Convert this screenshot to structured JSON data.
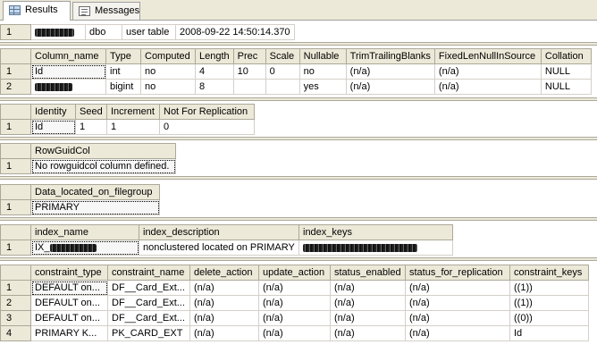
{
  "tabs": [
    {
      "label": "Results",
      "icon": "results-grid-icon"
    },
    {
      "label": "Messages",
      "icon": "messages-icon"
    }
  ],
  "rs1": {
    "row": {
      "num": "1",
      "owner": "dbo",
      "type": "user table",
      "created": "2008-09-22 14:50:14.370"
    }
  },
  "rs2": {
    "headers": [
      "Column_name",
      "Type",
      "Computed",
      "Length",
      "Prec",
      "Scale",
      "Nullable",
      "TrimTrailingBlanks",
      "FixedLenNullInSource",
      "Collation"
    ],
    "rows": [
      {
        "num": "1",
        "name": "Id",
        "type": "int",
        "computed": "no",
        "length": "4",
        "prec": "10",
        "scale": "0",
        "nullable": "no",
        "trim": "(n/a)",
        "fixed": "(n/a)",
        "collation": "NULL"
      },
      {
        "num": "2",
        "name": "",
        "type": "bigint",
        "computed": "no",
        "length": "8",
        "prec": "",
        "scale": "",
        "nullable": "yes",
        "trim": "(n/a)",
        "fixed": "(n/a)",
        "collation": "NULL"
      }
    ]
  },
  "rs3": {
    "headers": [
      "Identity",
      "Seed",
      "Increment",
      "Not For Replication"
    ],
    "row": {
      "num": "1",
      "identity": "Id",
      "seed": "1",
      "increment": "1",
      "nfr": "0"
    }
  },
  "rs4": {
    "header": "RowGuidCol",
    "row": {
      "num": "1",
      "value": "No rowguidcol column defined."
    }
  },
  "rs5": {
    "header": "Data_located_on_filegroup",
    "row": {
      "num": "1",
      "value": "PRIMARY"
    }
  },
  "rs6": {
    "headers": [
      "index_name",
      "index_description",
      "index_keys"
    ],
    "row": {
      "num": "1",
      "name_prefix": "IX_",
      "description": "nonclustered located on PRIMARY"
    }
  },
  "rs7": {
    "headers": [
      "constraint_type",
      "constraint_name",
      "delete_action",
      "update_action",
      "status_enabled",
      "status_for_replication",
      "constraint_keys"
    ],
    "rows": [
      {
        "num": "1",
        "type": "DEFAULT on...",
        "name": "DF__Card_Ext...",
        "del": "(n/a)",
        "upd": "(n/a)",
        "enabled": "(n/a)",
        "repl": "(n/a)",
        "keys": "((1))"
      },
      {
        "num": "2",
        "type": "DEFAULT on...",
        "name": "DF__Card_Ext...",
        "del": "(n/a)",
        "upd": "(n/a)",
        "enabled": "(n/a)",
        "repl": "(n/a)",
        "keys": "((1))"
      },
      {
        "num": "3",
        "type": "DEFAULT on...",
        "name": "DF__Card_Ext...",
        "del": "(n/a)",
        "upd": "(n/a)",
        "enabled": "(n/a)",
        "repl": "(n/a)",
        "keys": "((0))"
      },
      {
        "num": "4",
        "type": "PRIMARY K...",
        "name": "PK_CARD_EXT",
        "del": "(n/a)",
        "upd": "(n/a)",
        "enabled": "(n/a)",
        "repl": "(n/a)",
        "keys": "Id"
      }
    ]
  }
}
